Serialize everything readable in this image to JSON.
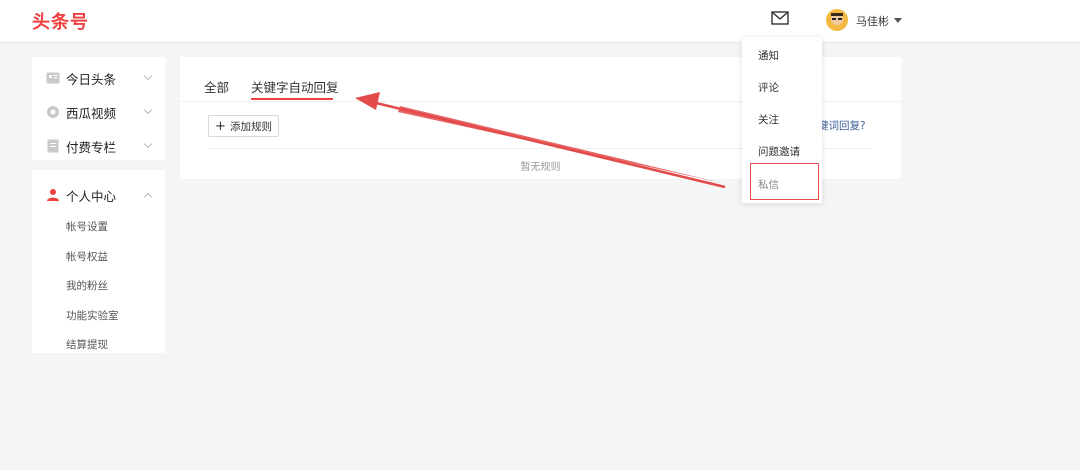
{
  "header": {
    "logo": "头条号",
    "username": "马佳彬",
    "mail_icon": "mail-icon",
    "avatar_icon": "avatar-icon"
  },
  "sidebar": {
    "menus": [
      {
        "label": "今日头条",
        "icon": "toutiao-icon"
      },
      {
        "label": "西瓜视频",
        "icon": "xigua-icon"
      },
      {
        "label": "付费专栏",
        "icon": "column-icon"
      }
    ],
    "personal": {
      "label": "个人中心",
      "icon": "user-icon",
      "items": [
        "帐号设置",
        "帐号权益",
        "我的粉丝",
        "功能实验室",
        "结算提现"
      ]
    }
  },
  "main": {
    "tabs": [
      "全部",
      "关键字自动回复"
    ],
    "active_tab": "关键字自动回复",
    "add_rule_label": "添加规则",
    "help_link": "键词回复?",
    "empty_text": "暂无规则"
  },
  "dropdown": {
    "items": [
      "通知",
      "评论",
      "关注",
      "问题邀请",
      "私信"
    ],
    "highlighted": "私信"
  },
  "colors": {
    "accent": "#f04142",
    "link": "#406599",
    "annotation": "#e34a4a"
  }
}
